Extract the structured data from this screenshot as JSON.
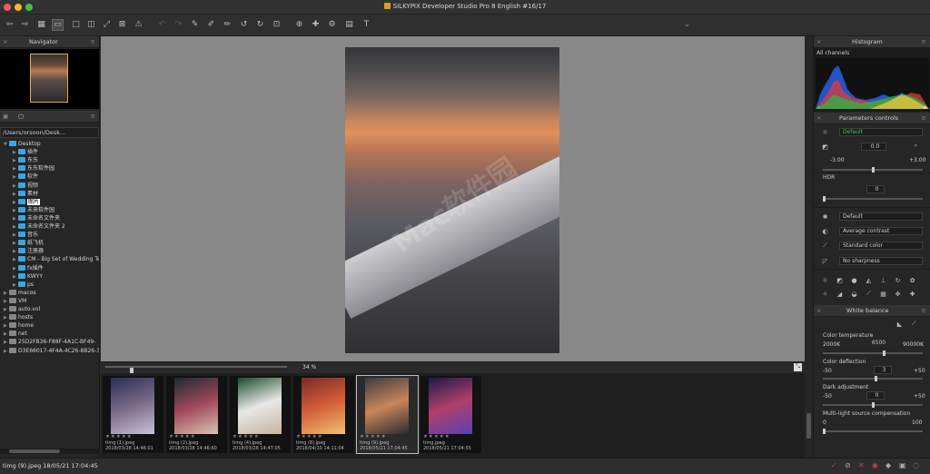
{
  "window": {
    "title": "SILKYPIX Developer Studio Pro #16 - English #16/17",
    "title_visible": "SILKYPIX Developer Studio Pro 8 English #16/17",
    "traffic_lights": [
      "#f15b57",
      "#f7b52c",
      "#3fc540"
    ]
  },
  "navigator": {
    "title": "Navigator"
  },
  "browser": {
    "path": "/Users/orsoon/Desk...",
    "tree": [
      {
        "label": "Desktop",
        "depth": 0,
        "open": true
      },
      {
        "label": "插件",
        "depth": 1
      },
      {
        "label": "东东",
        "depth": 1
      },
      {
        "label": "东东软件园",
        "depth": 1
      },
      {
        "label": "软件",
        "depth": 1
      },
      {
        "label": "视频",
        "depth": 1
      },
      {
        "label": "素材",
        "depth": 1
      },
      {
        "label": "图片",
        "depth": 1,
        "selected": true
      },
      {
        "label": "未来软件园",
        "depth": 1
      },
      {
        "label": "未命名文件夹",
        "depth": 1
      },
      {
        "label": "未命名文件夹 2",
        "depth": 1
      },
      {
        "label": "音乐",
        "depth": 1
      },
      {
        "label": "纸飞机",
        "depth": 1
      },
      {
        "label": "注册器",
        "depth": 1
      },
      {
        "label": "CM - Big Set of Wedding Te",
        "depth": 1
      },
      {
        "label": "fx插件",
        "depth": 1
      },
      {
        "label": "KWYY",
        "depth": 1
      },
      {
        "label": "ps",
        "depth": 1
      },
      {
        "label": "macos",
        "depth": 0
      },
      {
        "label": "VM",
        "depth": 0
      },
      {
        "label": "auto.vol",
        "depth": 0
      },
      {
        "label": "hosts",
        "depth": 0
      },
      {
        "label": "home",
        "depth": 0
      },
      {
        "label": "net",
        "depth": 0
      },
      {
        "label": "25D2FB36-F88F-4A1C-BF49-",
        "depth": 0
      },
      {
        "label": "D3E66017-4F4A-4C26-8B26-3",
        "depth": 0
      }
    ]
  },
  "viewer": {
    "zoom": "34 %",
    "watermark": "Mac软件园"
  },
  "filmstrip": [
    {
      "name": "timg (1).jpeg",
      "date": "2018/03/28 14:46:01",
      "rating": "★★★★★",
      "colors": [
        "#2b2c55",
        "#7a6a88",
        "#c8c3d8"
      ]
    },
    {
      "name": "timg (2).jpeg",
      "date": "2018/03/28 14:46:60",
      "rating": "★★★★★",
      "colors": [
        "#1d2b33",
        "#a0485a",
        "#d8c3b2"
      ]
    },
    {
      "name": "timg (4).jpeg",
      "date": "2018/03/28 14:47:05",
      "rating": "★★★★★",
      "colors": [
        "#1d4a2a",
        "#e8e8e8",
        "#c7b39c"
      ]
    },
    {
      "name": "timg (8).jpeg",
      "date": "2018/04/10 14:11:04",
      "rating": "★★★★★",
      "colors": [
        "#7a2a24",
        "#d35e3a",
        "#f0c070"
      ]
    },
    {
      "name": "timg (9).jpeg",
      "date": "2018/05/21 17:04:45",
      "rating": "★★★★★",
      "selected": true,
      "colors": [
        "#3a3a3e",
        "#c9855a",
        "#2c2c30"
      ]
    },
    {
      "name": "timg.jpeg",
      "date": "2018/05/21 17:04:55",
      "rating": "★★★★★",
      "colors": [
        "#1e1848",
        "#b0406a",
        "#5a40b0"
      ]
    }
  ],
  "histogram": {
    "title": "Histogram",
    "channel": "All channels"
  },
  "params": {
    "title": "Parameters controls",
    "taste": "Default",
    "exposure_value": "0.0",
    "exp_min": "-3.00",
    "exp_max": "+3.00",
    "hdr_label": "HDR",
    "hdr_value": "0",
    "tone": "Default",
    "contrast": "Average contrast",
    "color": "Standard color",
    "sharpness": "No sharpness"
  },
  "white_balance": {
    "title": "White balance",
    "temp_label": "Color temperature",
    "temp_min": "2000K",
    "temp_value": "6500",
    "temp_max": "90000K",
    "defl_label": "Color deflection",
    "defl_min": "-50",
    "defl_value": "3",
    "defl_max": "+50",
    "dark_label": "Dark adjustment",
    "dark_min": "-50",
    "dark_value": "0",
    "dark_max": "+50",
    "multi_label": "Multi-light source compensation",
    "multi_min": "0",
    "multi_max": "100"
  },
  "status": {
    "text": "timg (9).jpeg 18/05/21 17:04:45"
  }
}
